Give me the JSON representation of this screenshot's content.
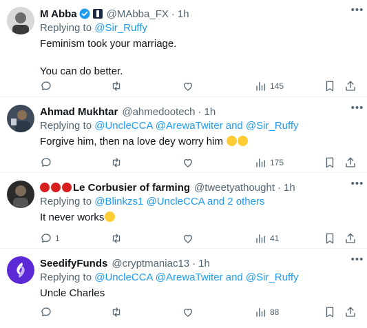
{
  "tweets": [
    {
      "name": "M Abba",
      "handle": "@MAbba_FX",
      "time": "1h",
      "replying_prefix": "Replying to",
      "replying_to": "@Sir_Ruffy",
      "text_line1": "Feminism took your marriage.",
      "text_line2": "You can do better.",
      "replies": "",
      "retweets": "",
      "likes": "",
      "views": "145"
    },
    {
      "name": "Ahmad Mukhtar",
      "handle": "@ahmedootech",
      "time": "1h",
      "replying_prefix": "Replying to",
      "replying_to": "@UncleCCA @ArewaTwiter and @Sir_Ruffy",
      "text": "Forgive him, then na love dey worry him",
      "replies": "",
      "views": "175"
    },
    {
      "name": "Le Corbusier of farming",
      "handle": "@tweetyathought",
      "time": "1h",
      "replying_prefix": "Replying to",
      "replying_to": "@Blinkzs1 @UncleCCA and 2 others",
      "text": "It never works",
      "replies": "1",
      "views": "41"
    },
    {
      "name": "SeedifyFunds",
      "handle": "@cryptmaniac13",
      "time": "1h",
      "replying_prefix": "Replying to",
      "replying_to": "@UncleCCA @ArewaTwiter and @Sir_Ruffy",
      "text": "Uncle Charles",
      "replies": "",
      "views": "88"
    }
  ],
  "separator": "·",
  "icons": {
    "verified": "verified-badge-icon",
    "reply": "reply-icon",
    "retweet": "retweet-icon",
    "like": "heart-icon",
    "views": "views-icon",
    "bookmark": "bookmark-icon",
    "share": "share-icon",
    "more": "more-icon"
  },
  "colors": {
    "link": "#1d9bf0",
    "secondary": "#536471",
    "verified": "#1d9bf0"
  }
}
